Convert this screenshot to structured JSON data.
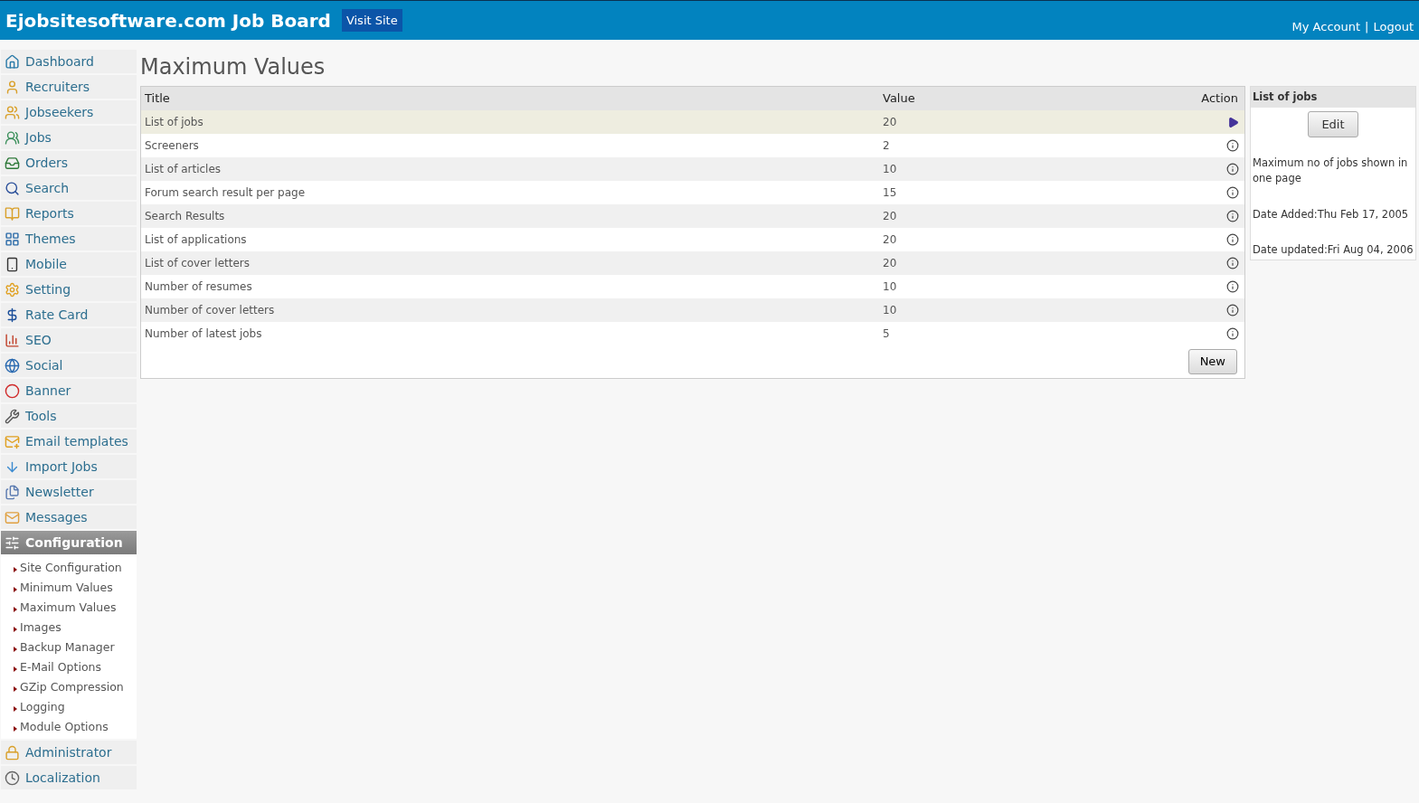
{
  "header": {
    "title": "Ejobsitesoftware.com Job Board",
    "visit_button": "Visit Site",
    "links": [
      "My Account",
      "Logout"
    ],
    "separator": "|"
  },
  "sidebar": {
    "items": [
      {
        "label": "Dashboard",
        "selected": false
      },
      {
        "label": "Recruiters",
        "selected": false
      },
      {
        "label": "Jobseekers",
        "selected": false
      },
      {
        "label": "Jobs",
        "selected": false
      },
      {
        "label": "Orders",
        "selected": false
      },
      {
        "label": "Search",
        "selected": false
      },
      {
        "label": "Reports",
        "selected": false
      },
      {
        "label": "Themes",
        "selected": false
      },
      {
        "label": "Mobile",
        "selected": false
      },
      {
        "label": "Setting",
        "selected": false
      },
      {
        "label": "Rate Card",
        "selected": false
      },
      {
        "label": "SEO",
        "selected": false
      },
      {
        "label": "Social",
        "selected": false
      },
      {
        "label": "Banner",
        "selected": false
      },
      {
        "label": "Tools",
        "selected": false
      },
      {
        "label": "Email templates",
        "selected": false
      },
      {
        "label": "Import Jobs",
        "selected": false
      },
      {
        "label": "Newsletter",
        "selected": false
      },
      {
        "label": "Messages",
        "selected": false
      },
      {
        "label": "Configuration",
        "selected": true,
        "children": [
          {
            "label": "Site Configuration"
          },
          {
            "label": "Minimum Values"
          },
          {
            "label": "Maximum Values"
          },
          {
            "label": "Images"
          },
          {
            "label": "Backup Manager"
          },
          {
            "label": "E-Mail Options"
          },
          {
            "label": "GZip Compression"
          },
          {
            "label": "Logging"
          },
          {
            "label": "Module Options"
          }
        ]
      },
      {
        "label": "Administrator",
        "selected": false
      },
      {
        "label": "Localization",
        "selected": false
      }
    ]
  },
  "page_title": "Maximum Values",
  "table": {
    "columns": [
      "Title",
      "Value",
      "Action"
    ],
    "rows": [
      {
        "title": "List of jobs",
        "value": "20",
        "selected": true
      },
      {
        "title": "Screeners",
        "value": "2",
        "selected": false
      },
      {
        "title": "List of articles",
        "value": "10",
        "selected": false
      },
      {
        "title": "Forum search result per page",
        "value": "15",
        "selected": false
      },
      {
        "title": "Search Results",
        "value": "20",
        "selected": false
      },
      {
        "title": "List of applications",
        "value": "20",
        "selected": false
      },
      {
        "title": "List of cover letters",
        "value": "20",
        "selected": false
      },
      {
        "title": "Number of resumes",
        "value": "10",
        "selected": false
      },
      {
        "title": "Number of cover letters",
        "value": "10",
        "selected": false
      },
      {
        "title": "Number of latest jobs",
        "value": "5",
        "selected": false
      }
    ],
    "new_button": "New"
  },
  "detail": {
    "title": "List of jobs",
    "edit_button": "Edit",
    "description": "Maximum no of jobs shown in one page",
    "date_added": "Date Added:Thu Feb 17, 2005",
    "date_updated": "Date updated:Fri Aug 04, 2006"
  }
}
